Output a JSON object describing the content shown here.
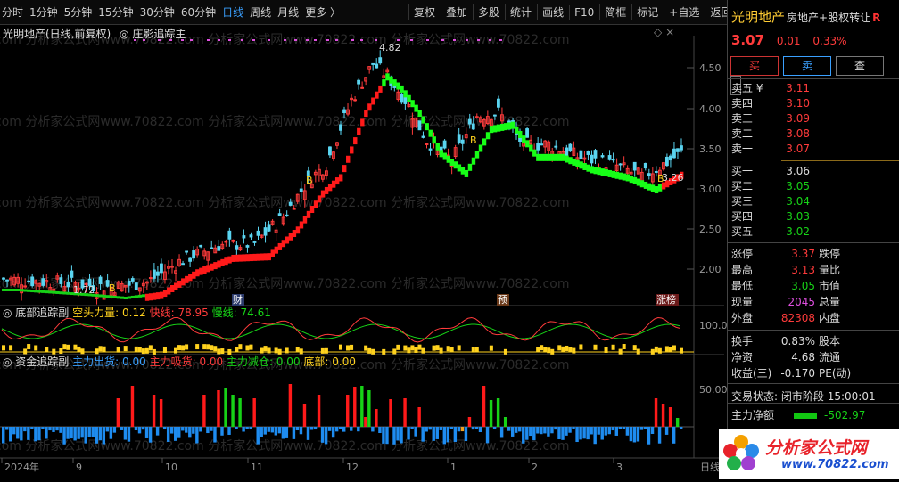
{
  "toolbar": {
    "periods": [
      "分时",
      "1分钟",
      "5分钟",
      "15分钟",
      "30分钟",
      "60分钟",
      "日线",
      "周线",
      "月线",
      "更多 〉"
    ],
    "active_period": "日线",
    "tools": [
      "复权",
      "叠加",
      "多股",
      "统计",
      "画线",
      "F10",
      "简框",
      "标记",
      "+自选",
      "返回"
    ]
  },
  "chart_header": {
    "title": "光明地产(日线,前复权)",
    "indicator": "庄影追踪主"
  },
  "price_axis": [
    "4.50",
    "4.00",
    "3.50",
    "3.00",
    "2.50",
    "2.00"
  ],
  "price_labels": {
    "high": "4.82",
    "low_left": "1.72",
    "last": "3.26"
  },
  "markers": {
    "b": "B",
    "cai": "财",
    "yu": "预",
    "zhangbang": "涨榜"
  },
  "sub1": {
    "name": "底部追踪副",
    "k1": "空头力量:",
    "v1": "0.12",
    "k2": "快线:",
    "v2": "78.95",
    "k3": "慢线:",
    "v3": "74.61",
    "axis": "100.0"
  },
  "sub2": {
    "name": "资金追踪副",
    "k1": "主力出货:",
    "v1": "0.00",
    "k2": "主力吸货:",
    "v2": "0.00",
    "k3": "主力减仓:",
    "v3": "0.00",
    "k4": "底部:",
    "v4": "0.00",
    "axis": "50.00"
  },
  "date_axis": [
    "2024年",
    "9",
    "10",
    "11",
    "12",
    "1",
    "2",
    "3",
    "日线"
  ],
  "watermark": "com 分析家公式网www.70822.com 分析家公式网www.70822.com 分析家公式网www.70822.com",
  "right_panel": {
    "name": "光明地产",
    "tag": "房地产+股权转让",
    "r": "R",
    "price": "3.07",
    "change": "0.01",
    "pct": "0.33%",
    "btn_buy": "买",
    "btn_sell": "卖",
    "btn_query": "查",
    "asks": [
      {
        "label": "卖五 ¥",
        "price": "3.11"
      },
      {
        "label": "卖四",
        "price": "3.10"
      },
      {
        "label": "卖三",
        "price": "3.09"
      },
      {
        "label": "卖二",
        "price": "3.08"
      },
      {
        "label": "卖一",
        "price": "3.07"
      }
    ],
    "bids": [
      {
        "label": "买一",
        "price": "3.06"
      },
      {
        "label": "买二",
        "price": "3.05"
      },
      {
        "label": "买三",
        "price": "3.04"
      },
      {
        "label": "买四",
        "price": "3.03"
      },
      {
        "label": "买五",
        "price": "3.02"
      }
    ],
    "stats1": [
      {
        "k": "涨停",
        "v": "3.37",
        "c": "red",
        "k2": "跌停"
      },
      {
        "k": "最高",
        "v": "3.13",
        "c": "red",
        "k2": "量比"
      },
      {
        "k": "最低",
        "v": "3.05",
        "c": "green",
        "k2": "市值"
      },
      {
        "k": "现量",
        "v": "2045",
        "c": "mag",
        "k2": "总量"
      },
      {
        "k": "外盘",
        "v": "82308",
        "c": "red",
        "k2": "内盘"
      }
    ],
    "stats2": [
      {
        "k": "换手",
        "v": "0.83%",
        "c": "white",
        "k2": "股本"
      },
      {
        "k": "净资",
        "v": "4.68",
        "c": "white",
        "k2": "流通"
      },
      {
        "k": "收益(三)",
        "v": "-0.170",
        "c": "white",
        "k2": "PE(动)"
      }
    ],
    "trade_state_label": "交易状态:",
    "trade_state": "闭市阶段",
    "trade_time": "15:00:01",
    "net_flow_label": "主力净额",
    "net_flow": "-502.97"
  },
  "logo": {
    "text": "分析家公式网",
    "url": "www.70822.com"
  },
  "colors": {
    "up": "#ff3b3b",
    "down": "#17d217",
    "cyan": "#5ad4f0",
    "yellow": "#ffd21e",
    "blue": "#1e8cf0"
  }
}
